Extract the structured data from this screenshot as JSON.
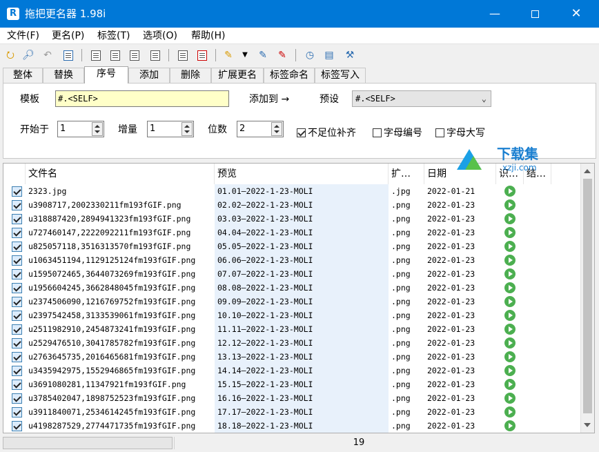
{
  "window": {
    "title": "拖把更名器 1.98i",
    "app_icon": "R",
    "controls": {
      "minimize": "—",
      "close": "✕"
    }
  },
  "menu": [
    {
      "label": "文件(F)"
    },
    {
      "label": "更名(P)"
    },
    {
      "label": "标签(T)"
    },
    {
      "label": "选项(O)"
    },
    {
      "label": "帮助(H)"
    }
  ],
  "toolbar_icons": [
    "open-folder-icon",
    "search-icon",
    "undo-icon",
    "check-icon",
    "tag-edit-1-icon",
    "tag-edit-2-icon",
    "tag-edit-3-icon",
    "tag-edit-4-icon",
    "document-icon",
    "document-red-icon",
    "pen-icon",
    "dropdown-arrow-icon",
    "rename-pen-icon",
    "delete-pen-icon",
    "clock-icon",
    "window-icon",
    "tools-icon"
  ],
  "tabs": [
    {
      "label": "整体"
    },
    {
      "label": "替换"
    },
    {
      "label": "序号"
    },
    {
      "label": "添加"
    },
    {
      "label": "删除"
    },
    {
      "label": "扩展更名"
    },
    {
      "label": "标签命名"
    },
    {
      "label": "标签写入"
    }
  ],
  "active_tab": "序号",
  "sequence": {
    "template_label": "模板",
    "template_value": "#.<SELF>",
    "add_to_label": "添加到 →",
    "preset_label": "预设",
    "preset_value": "#.<SELF>",
    "start_label": "开始于",
    "start_value": "1",
    "step_label": "增量",
    "step_value": "1",
    "digits_label": "位数",
    "digits_value": "2",
    "options": [
      {
        "label": "不足位补齐",
        "checked": true
      },
      {
        "label": "字母编号",
        "checked": false
      },
      {
        "label": "字母大写",
        "checked": false
      }
    ]
  },
  "watermark": {
    "title": "下载集",
    "subtitle": "xzji.com"
  },
  "list": {
    "columns": [
      "文件名",
      "预览",
      "扩…",
      "日期",
      "识…",
      "结…"
    ],
    "rows": [
      {
        "name": "2323.jpg",
        "preview": "01.01—2022-1-23-MOLI",
        "ext": ".jpg",
        "date": "2022-01-21"
      },
      {
        "name": "u3908717,2002330211fm193fGIF.png",
        "preview": "02.02—2022-1-23-MOLI",
        "ext": ".png",
        "date": "2022-01-23"
      },
      {
        "name": "u318887420,2894941323fm193fGIF.png",
        "preview": "03.03—2022-1-23-MOLI",
        "ext": ".png",
        "date": "2022-01-23"
      },
      {
        "name": "u727460147,2222092211fm193fGIF.png",
        "preview": "04.04—2022-1-23-MOLI",
        "ext": ".png",
        "date": "2022-01-23"
      },
      {
        "name": "u825057118,3516313570fm193fGIF.png",
        "preview": "05.05—2022-1-23-MOLI",
        "ext": ".png",
        "date": "2022-01-23"
      },
      {
        "name": "u1063451194,1129125124fm193fGIF.png",
        "preview": "06.06—2022-1-23-MOLI",
        "ext": ".png",
        "date": "2022-01-23"
      },
      {
        "name": "u1595072465,3644073269fm193fGIF.png",
        "preview": "07.07—2022-1-23-MOLI",
        "ext": ".png",
        "date": "2022-01-23"
      },
      {
        "name": "u1956604245,3662848045fm193fGIF.png",
        "preview": "08.08—2022-1-23-MOLI",
        "ext": ".png",
        "date": "2022-01-23"
      },
      {
        "name": "u2374506090,1216769752fm193fGIF.png",
        "preview": "09.09—2022-1-23-MOLI",
        "ext": ".png",
        "date": "2022-01-23"
      },
      {
        "name": "u2397542458,3133539061fm193fGIF.png",
        "preview": "10.10—2022-1-23-MOLI",
        "ext": ".png",
        "date": "2022-01-23"
      },
      {
        "name": "u2511982910,2454873241fm193fGIF.png",
        "preview": "11.11—2022-1-23-MOLI",
        "ext": ".png",
        "date": "2022-01-23"
      },
      {
        "name": "u2529476510,3041785782fm193fGIF.png",
        "preview": "12.12—2022-1-23-MOLI",
        "ext": ".png",
        "date": "2022-01-23"
      },
      {
        "name": "u2763645735,2016465681fm193fGIF.png",
        "preview": "13.13—2022-1-23-MOLI",
        "ext": ".png",
        "date": "2022-01-23"
      },
      {
        "name": "u3435942975,1552946865fm193fGIF.png",
        "preview": "14.14—2022-1-23-MOLI",
        "ext": ".png",
        "date": "2022-01-23"
      },
      {
        "name": "u3691080281,11347921fm193fGIF.png",
        "preview": "15.15—2022-1-23-MOLI",
        "ext": ".png",
        "date": "2022-01-23"
      },
      {
        "name": "u3785402047,1898752523fm193fGIF.png",
        "preview": "16.16—2022-1-23-MOLI",
        "ext": ".png",
        "date": "2022-01-23"
      },
      {
        "name": "u3911840071,2534614245fm193fGIF.png",
        "preview": "17.17—2022-1-23-MOLI",
        "ext": ".png",
        "date": "2022-01-23"
      },
      {
        "name": "u4198287529,2774471735fm193fGIF.png",
        "preview": "18.18—2022-1-23-MOLI",
        "ext": ".png",
        "date": "2022-01-23"
      }
    ]
  },
  "status": {
    "count": "19"
  },
  "colors": {
    "titlebar": "#0078d7",
    "preview_bg": "#e8f1fb",
    "status_ok": "#4caf50"
  }
}
